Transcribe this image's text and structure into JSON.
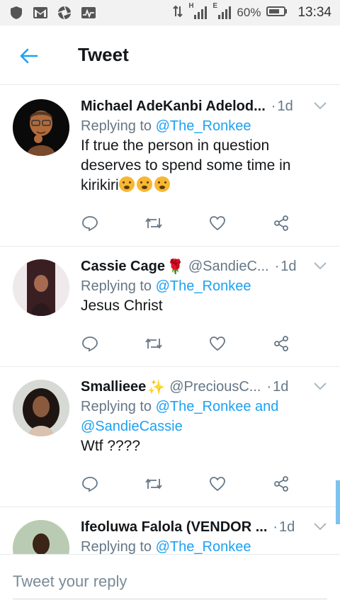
{
  "status_bar": {
    "battery_percent": "60%",
    "time": "13:34",
    "network_h": "H",
    "network_e": "E",
    "icons": [
      "shield-icon",
      "gmail-icon",
      "camera-aperture-icon",
      "activity-icon",
      "data-arrows-icon",
      "signal-h-icon",
      "signal-e-icon",
      "battery-icon"
    ]
  },
  "header": {
    "title": "Tweet",
    "back_icon": "arrow-left-icon"
  },
  "colors": {
    "accent": "#1da1f2",
    "secondary_text": "#657786",
    "divider": "#e6ecf0"
  },
  "tweets": [
    {
      "name": "Michael AdeKanbi Adelod...",
      "handle": "",
      "time": "1d",
      "replying_label": "Replying to ",
      "mentions": "@The_Ronkee",
      "text": "If true the person in question deserves to spend some time in kirikiri"
    },
    {
      "name": "Cassie Cage",
      "name_emoji": "🌹",
      "handle": "@SandieC...",
      "time": "1d",
      "replying_label": "Replying to ",
      "mentions": "@The_Ronkee",
      "text": "Jesus Christ"
    },
    {
      "name": "Smallieee",
      "name_emoji": "✨",
      "handle": "@PreciousC...",
      "time": "1d",
      "replying_label": "Replying to ",
      "mentions": "@The_Ronkee and @SandieCassie",
      "text": "Wtf ????"
    },
    {
      "name": "Ifeoluwa Falola (VENDOR ...",
      "handle": "",
      "time": "1d",
      "replying_label": "Replying to ",
      "mentions": "@The_Ronkee",
      "text": ""
    }
  ],
  "reply_bar": {
    "placeholder": "Tweet your reply"
  },
  "dot_separator": "·"
}
